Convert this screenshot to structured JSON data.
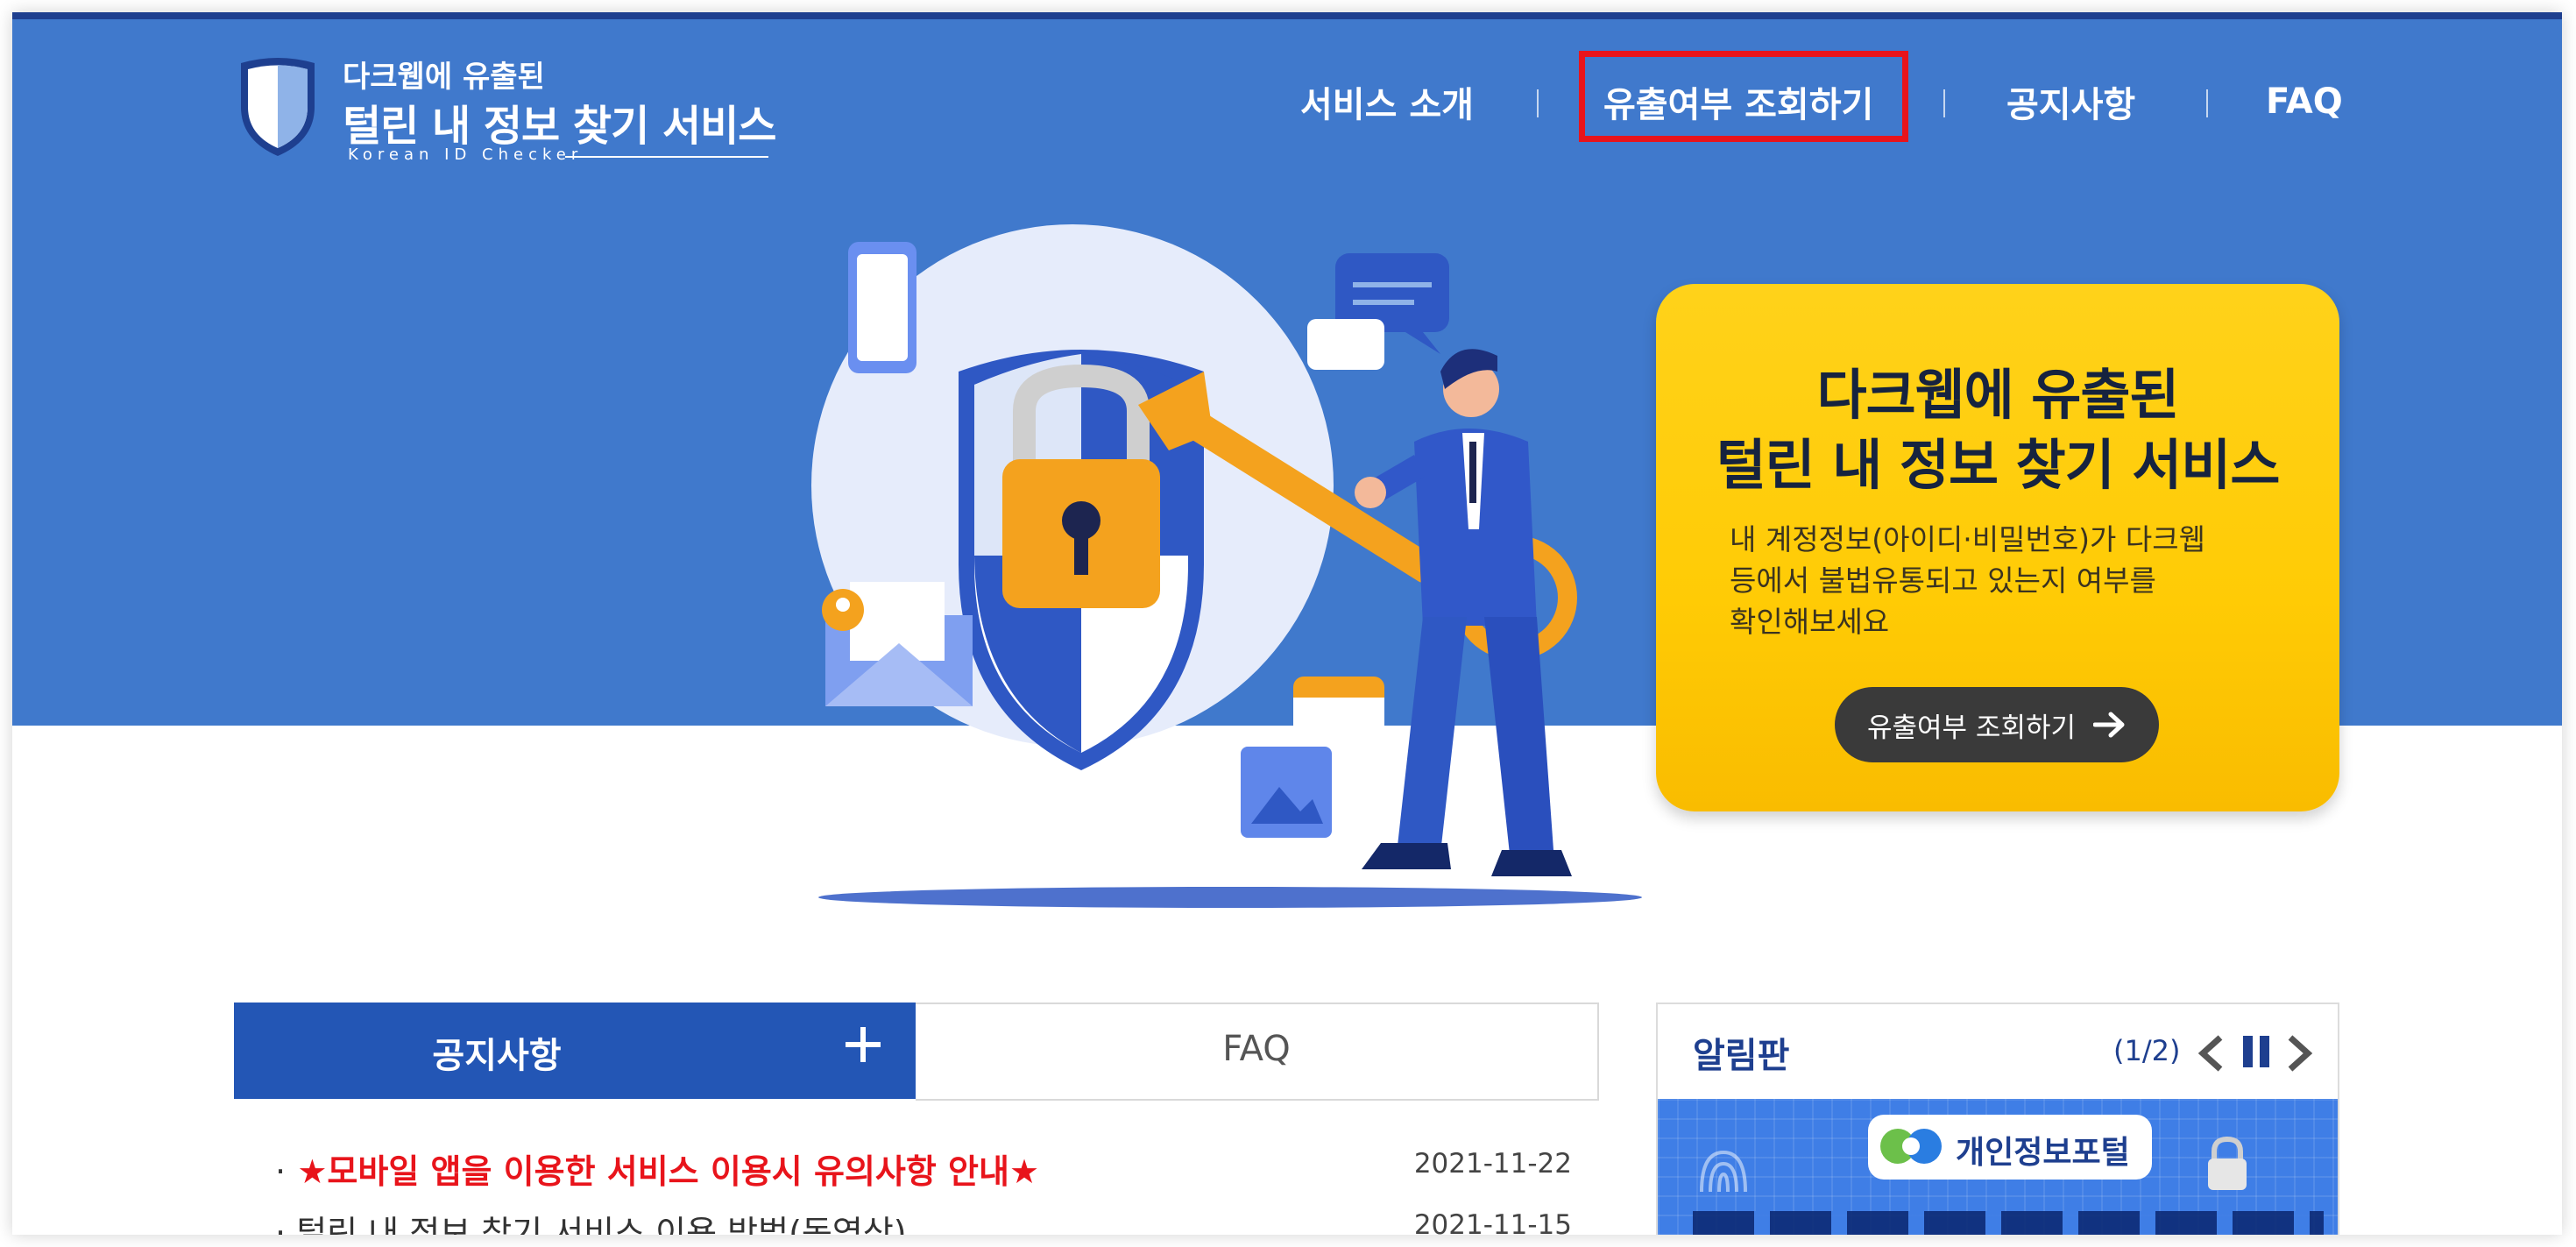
{
  "header": {
    "logo_sub": "다크웹에 유출된",
    "logo_main": "털린 내 정보 찾기 서비스",
    "logo_eng": "Korean ID Checker",
    "nav": [
      {
        "label": "서비스 소개"
      },
      {
        "label": "유출여부 조회하기"
      },
      {
        "label": "공지사항"
      },
      {
        "label": "FAQ"
      }
    ]
  },
  "hero_card": {
    "title_line1": "다크웹에 유출된",
    "title_line2": "털린 내 정보 찾기 서비스",
    "desc_line1": "내 계정정보(아이디·비밀번호)가 다크웹",
    "desc_line2": "등에서 불법유통되고 있는지 여부를",
    "desc_line3": "확인해보세요",
    "button_label": "유출여부 조회하기"
  },
  "tabs": {
    "notice_label": "공지사항",
    "faq_label": "FAQ"
  },
  "notices": [
    {
      "bullet": "·",
      "title": "★모바일 앱을 이용한 서비스 이용시 유의사항 안내★",
      "date": "2021-11-22",
      "color": "#e8141b"
    },
    {
      "bullet": "·",
      "title": "털린 내 정보 찾기 서비스 이용 방법(동영상)",
      "date": "2021-11-15",
      "color": "#333333"
    }
  ],
  "board": {
    "title": "알림판",
    "page": "(1/2)",
    "banner_label": "개인정보포털"
  },
  "colors": {
    "hero_blue": "#4079cc",
    "navy": "#1e3f8f",
    "card_yellow": "#ffcb05",
    "highlight_red": "#e8141b"
  }
}
